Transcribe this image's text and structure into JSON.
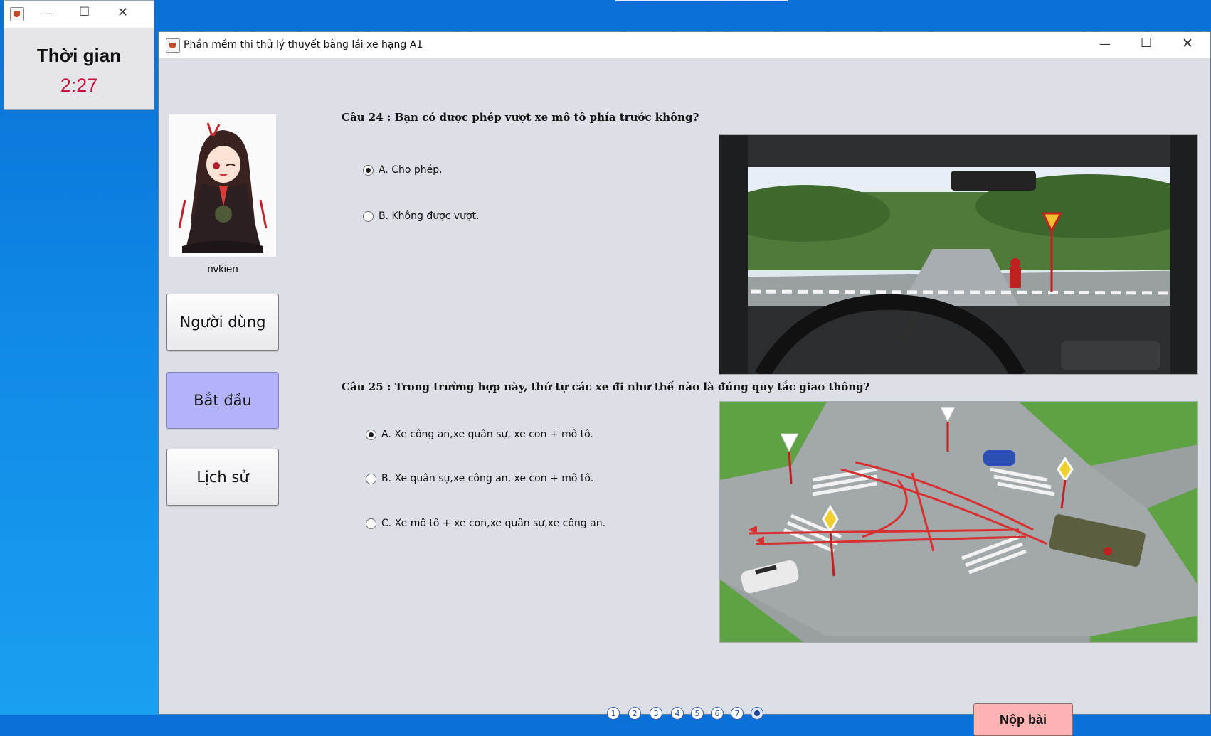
{
  "timer_window": {
    "label": "Thời gian",
    "value": "2:27"
  },
  "main_window": {
    "title": "Phần mềm thi thử lý thuyết bằng lái xe hạng A1"
  },
  "user": {
    "name": "nvkien"
  },
  "sidebar": {
    "buttons": [
      {
        "label": "Người dùng",
        "active": false
      },
      {
        "label": "Bắt đầu",
        "active": true
      },
      {
        "label": "Lịch sử",
        "active": false
      }
    ]
  },
  "questions": [
    {
      "text": "Câu 24 : Bạn có được phép vượt xe mô tô phía trước không?",
      "options": [
        {
          "label": "A. Cho phép.",
          "selected": true
        },
        {
          "label": "B. Không được vượt.",
          "selected": false
        }
      ]
    },
    {
      "text": "Câu 25 : Trong trường hợp này, thứ tự các xe đi như thế nào là đúng quy tắc giao thông?",
      "options": [
        {
          "label": "A. Xe công an,xe quân sự, xe con + mô tô.",
          "selected": true
        },
        {
          "label": "B. Xe quân sự,xe công an, xe con + mô tô.",
          "selected": false
        },
        {
          "label": "C. Xe mô tô + xe con,xe quân sự,xe công an.",
          "selected": false
        }
      ]
    }
  ],
  "pagination": {
    "pages": [
      "1",
      "2",
      "3",
      "4",
      "5",
      "6",
      "7",
      "8"
    ],
    "current_page": 8
  },
  "submit_label": "Nộp bài",
  "colors": {
    "timer_value": "#c4143c",
    "active_button": "#b3b3fb",
    "submit_button": "#ffb3b3"
  }
}
